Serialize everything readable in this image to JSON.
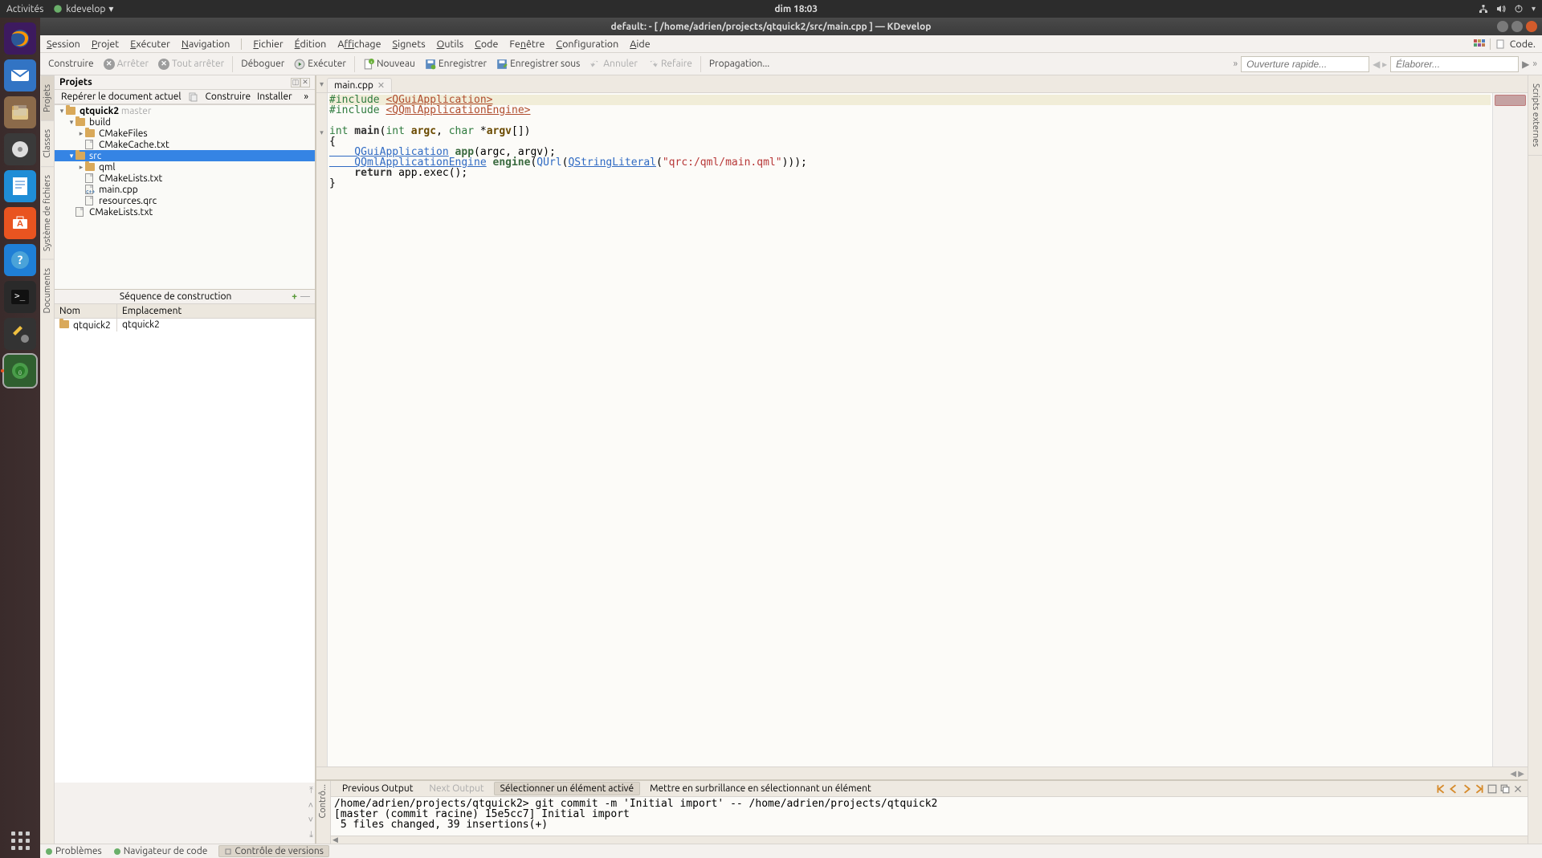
{
  "gnome": {
    "activities": "Activités",
    "app": "kdevelop",
    "clock": "dim 18:03"
  },
  "window": {
    "title": "default:  - [ /home/adrien/projects/qtquick2/src/main.cpp ] — KDevelop"
  },
  "menubar": {
    "items": [
      "Session",
      "Projet",
      "Exécuter",
      "Navigation",
      "Fichier",
      "Édition",
      "Affichage",
      "Signets",
      "Outils",
      "Code",
      "Fenêtre",
      "Configuration",
      "Aide"
    ],
    "right": "Code."
  },
  "toolbar": {
    "construire": "Construire",
    "arreter": "Arrêter",
    "tout_arreter": "Tout arrêter",
    "deboguer": "Déboguer",
    "executer": "Exécuter",
    "nouveau": "Nouveau",
    "enregistrer": "Enregistrer",
    "enregistrer_sous": "Enregistrer sous",
    "annuler": "Annuler",
    "refaire": "Refaire",
    "propagation": "Propagation...",
    "quickopen_placeholder": "Ouverture rapide...",
    "elaborate_placeholder": "Élaborer..."
  },
  "left_tabs": [
    "Documents",
    "Système de fichiers",
    "Classes",
    "Projets"
  ],
  "right_tab": "Scripts externes",
  "projects": {
    "title": "Projets",
    "reperer": "Repérer le document actuel",
    "construire": "Construire",
    "installer": "Installer",
    "tree": {
      "root": "qtquick2",
      "branch": "master",
      "build": "build",
      "cmakefiles": "CMakeFiles",
      "cmakecache": "CMakeCache.txt",
      "src": "src",
      "qml": "qml",
      "cmakelists1": "CMakeLists.txt",
      "maincpp": "main.cpp",
      "resources": "resources.qrc",
      "cmakelists2": "CMakeLists.txt"
    },
    "seq_title": "Séquence de construction",
    "col_nom": "Nom",
    "col_emp": "Emplacement",
    "row_nom": "qtquick2",
    "row_emp": "qtquick2"
  },
  "tab": {
    "filename": "main.cpp"
  },
  "code": {
    "l1a": "#include ",
    "l1b": "<QGuiApplication>",
    "l2a": "#include ",
    "l2b": "<QQmlApplicationEngine>",
    "l4a": "int",
    "l4b": " main",
    "l4c": "(",
    "l4d": "int",
    "l4e": " argc",
    "l4f": ", ",
    "l4g": "char",
    "l4h": " *",
    "l4i": "argv",
    "l4j": "[])",
    "l5": "{",
    "l6a": "    QGuiApplication",
    "l6b": " app",
    "l6c": "(argc, argv);",
    "l7a": "    QQmlApplicationEngine",
    "l7b": " engine",
    "l7c": "(",
    "l7d": "QUrl",
    "l7e": "(",
    "l7f": "QStringLiteral",
    "l7g": "(",
    "l7h": "\"qrc:/qml/main.qml\"",
    "l7i": ")));",
    "l8a": "    return",
    "l8b": " app.exec();",
    "l9": "}"
  },
  "output": {
    "prev": "Previous Output",
    "next": "Next Output",
    "select": "Sélectionner un élément activé",
    "highlight": "Mettre en surbrillance en sélectionnant un élément",
    "left_tab": "Contrô...",
    "l1": "/home/adrien/projects/qtquick2> git commit -m 'Initial import' -- /home/adrien/projects/qtquick2",
    "l2": "[master (commit racine) 15e5cc7] Initial import",
    "l3": " 5 files changed, 39 insertions(+)"
  },
  "statusbar": {
    "problemes": "Problèmes",
    "navigateur": "Navigateur de code",
    "controle": "Contrôle de versions"
  }
}
